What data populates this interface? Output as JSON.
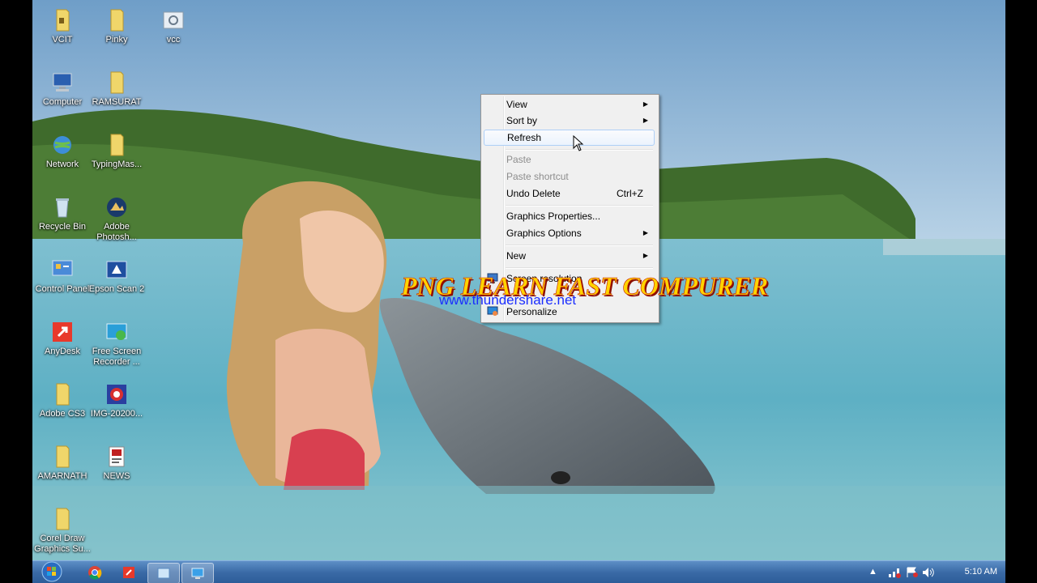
{
  "desktop": {
    "icons": [
      {
        "label": "VCIT",
        "icon": "folder-icon"
      },
      {
        "label": "Pinky",
        "icon": "folder-icon"
      },
      {
        "label": "vcc",
        "icon": "file-icon"
      },
      {
        "label": "Computer",
        "icon": "computer-icon"
      },
      {
        "label": "RAMSURAT",
        "icon": "folder-icon"
      },
      {
        "label": "Network",
        "icon": "network-icon"
      },
      {
        "label": "TypingMas...",
        "icon": "folder-icon"
      },
      {
        "label": "Recycle Bin",
        "icon": "recycle-bin-icon"
      },
      {
        "label": "Adobe Photosh...",
        "icon": "photoshop-icon"
      },
      {
        "label": "Control Panel",
        "icon": "control-panel-icon"
      },
      {
        "label": "Epson Scan 2",
        "icon": "scanner-icon"
      },
      {
        "label": "AnyDesk",
        "icon": "anydesk-icon"
      },
      {
        "label": "Free Screen Recorder ...",
        "icon": "screen-recorder-icon"
      },
      {
        "label": "Adobe CS3",
        "icon": "folder-icon"
      },
      {
        "label": "IMG-20200...",
        "icon": "image-icon"
      },
      {
        "label": "AMARNATH",
        "icon": "folder-icon"
      },
      {
        "label": "NEWS",
        "icon": "document-icon"
      },
      {
        "label": "Corel Draw Graphics Su...",
        "icon": "folder-icon"
      }
    ]
  },
  "context_menu": {
    "items": {
      "view": "View",
      "sort_by": "Sort by",
      "refresh": "Refresh",
      "paste": "Paste",
      "paste_shortcut": "Paste shortcut",
      "undo_delete": "Undo Delete",
      "undo_delete_shortcut": "Ctrl+Z",
      "graphics_properties": "Graphics Properties...",
      "graphics_options": "Graphics Options",
      "new": "New",
      "screen_resolution": "Screen resolution",
      "personalize": "Personalize"
    }
  },
  "overlay": {
    "title": "PNG LEARN FAST COMPURER",
    "url": "www.thundershare.net"
  },
  "taskbar": {
    "clock": "5:10 AM",
    "pinned": [
      "start-orb",
      "chrome-icon",
      "anydesk-icon",
      "explorer-icon",
      "remote-desktop-icon"
    ]
  },
  "colors": {
    "sky": "#8fb6d6",
    "sea": "#5fb3c6",
    "taskbar": "#3a6aa6",
    "overlay_title": "#ffd400",
    "overlay_url": "#1a2dff"
  }
}
